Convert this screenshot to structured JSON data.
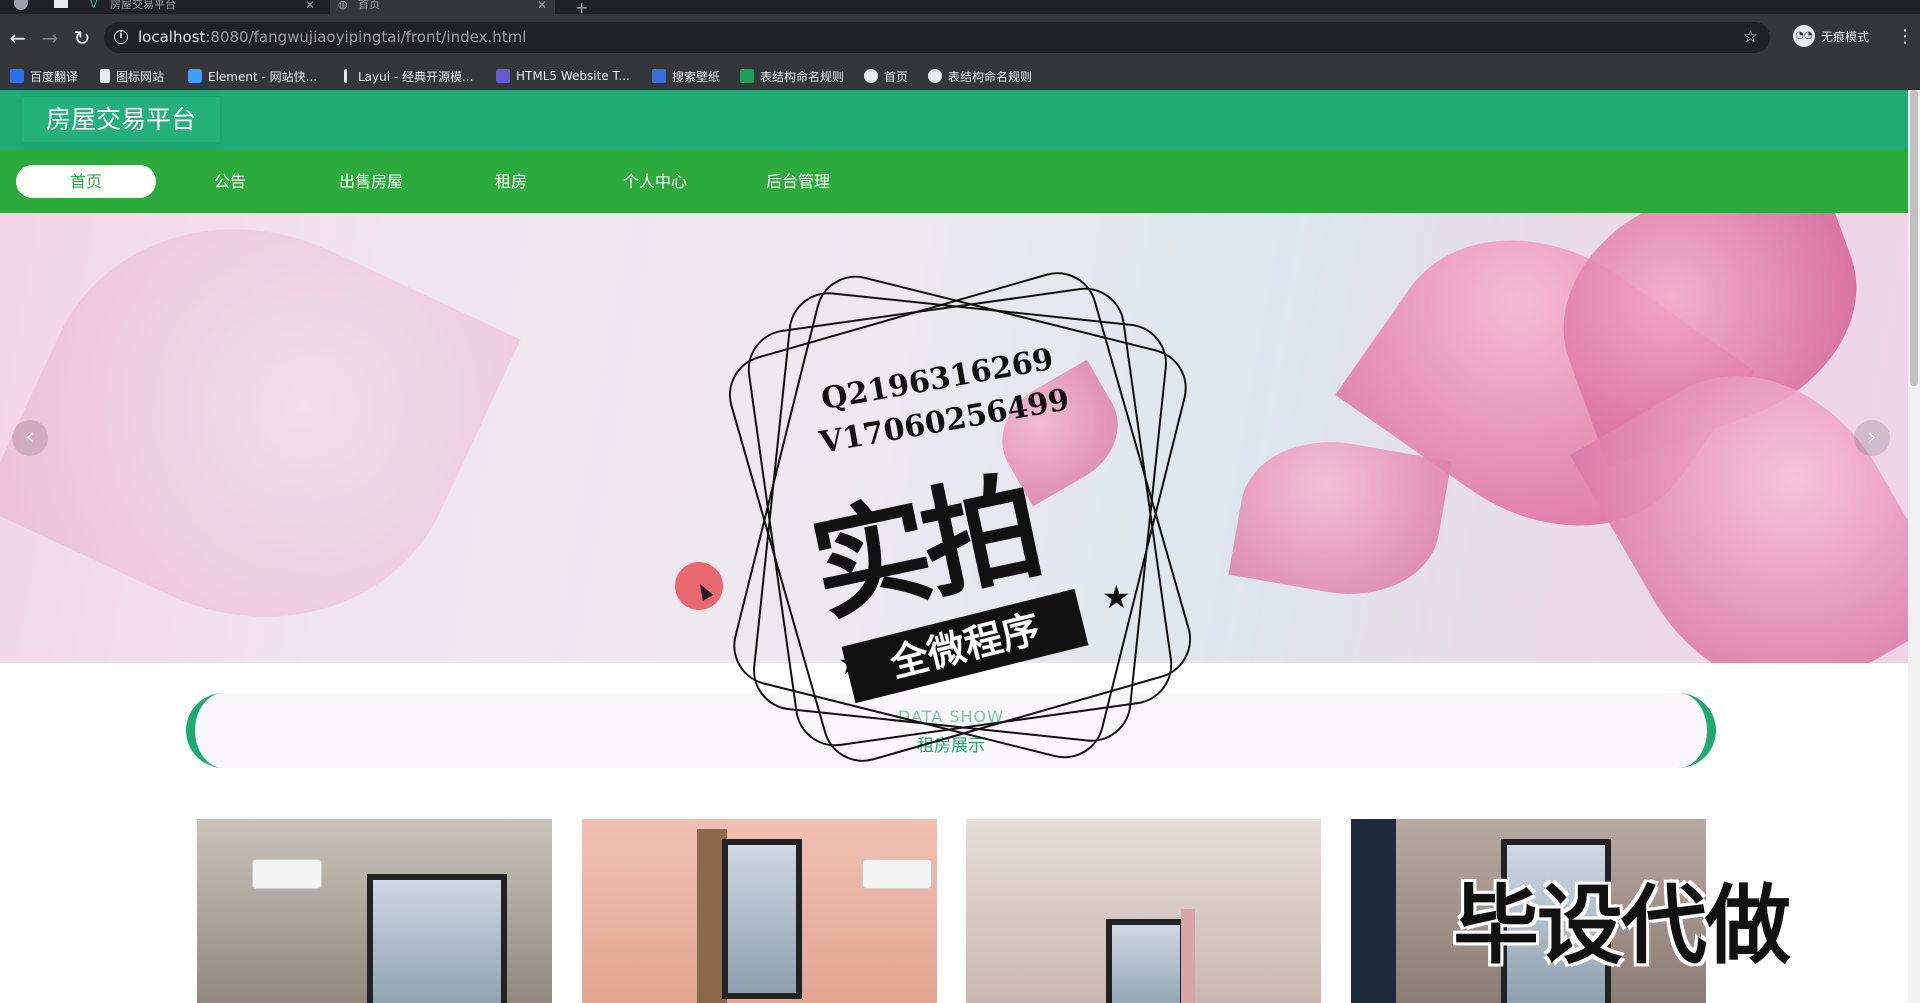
{
  "browser": {
    "tabs": [
      {
        "title": "房屋交易平台"
      },
      {
        "title": "首页"
      }
    ],
    "url_host": "localhost",
    "url_rest": ":8080/fangwujiaoyipingtai/front/index.html",
    "profile_label": "无痕模式",
    "bookmarks": [
      {
        "label": "百度翻译",
        "color": "#2f6fe8"
      },
      {
        "label": "图标网站",
        "color": "#e8eaed"
      },
      {
        "label": "Element - 网站快...",
        "color": "#409eff"
      },
      {
        "label": "Layui - 经典开源模...",
        "color": "#e8eaed"
      },
      {
        "label": "HTML5 Website T...",
        "color": "#6a5acd"
      },
      {
        "label": "搜索壁纸",
        "color": "#3b6fd8"
      },
      {
        "label": "表结构命名规则",
        "color": "#1e9e58"
      },
      {
        "label": "首页",
        "color": "#e8eaed"
      },
      {
        "label": "表结构命名规则",
        "color": "#e8eaed"
      }
    ]
  },
  "site": {
    "title": "房屋交易平台",
    "nav": [
      {
        "label": "首页",
        "active": true
      },
      {
        "label": "公告"
      },
      {
        "label": "出售房屋"
      },
      {
        "label": "租房"
      },
      {
        "label": "个人中心"
      },
      {
        "label": "后台管理"
      }
    ],
    "accent": "#1fa973",
    "nav_color": "#2daa3d"
  },
  "watermark": {
    "line1": "Q2196316269",
    "line2": "V17060256499",
    "big": "实拍",
    "ribbon": "全微程序",
    "corner": "毕设代做"
  },
  "section": {
    "en": "DATA SHOW",
    "cn": "租房展示"
  }
}
